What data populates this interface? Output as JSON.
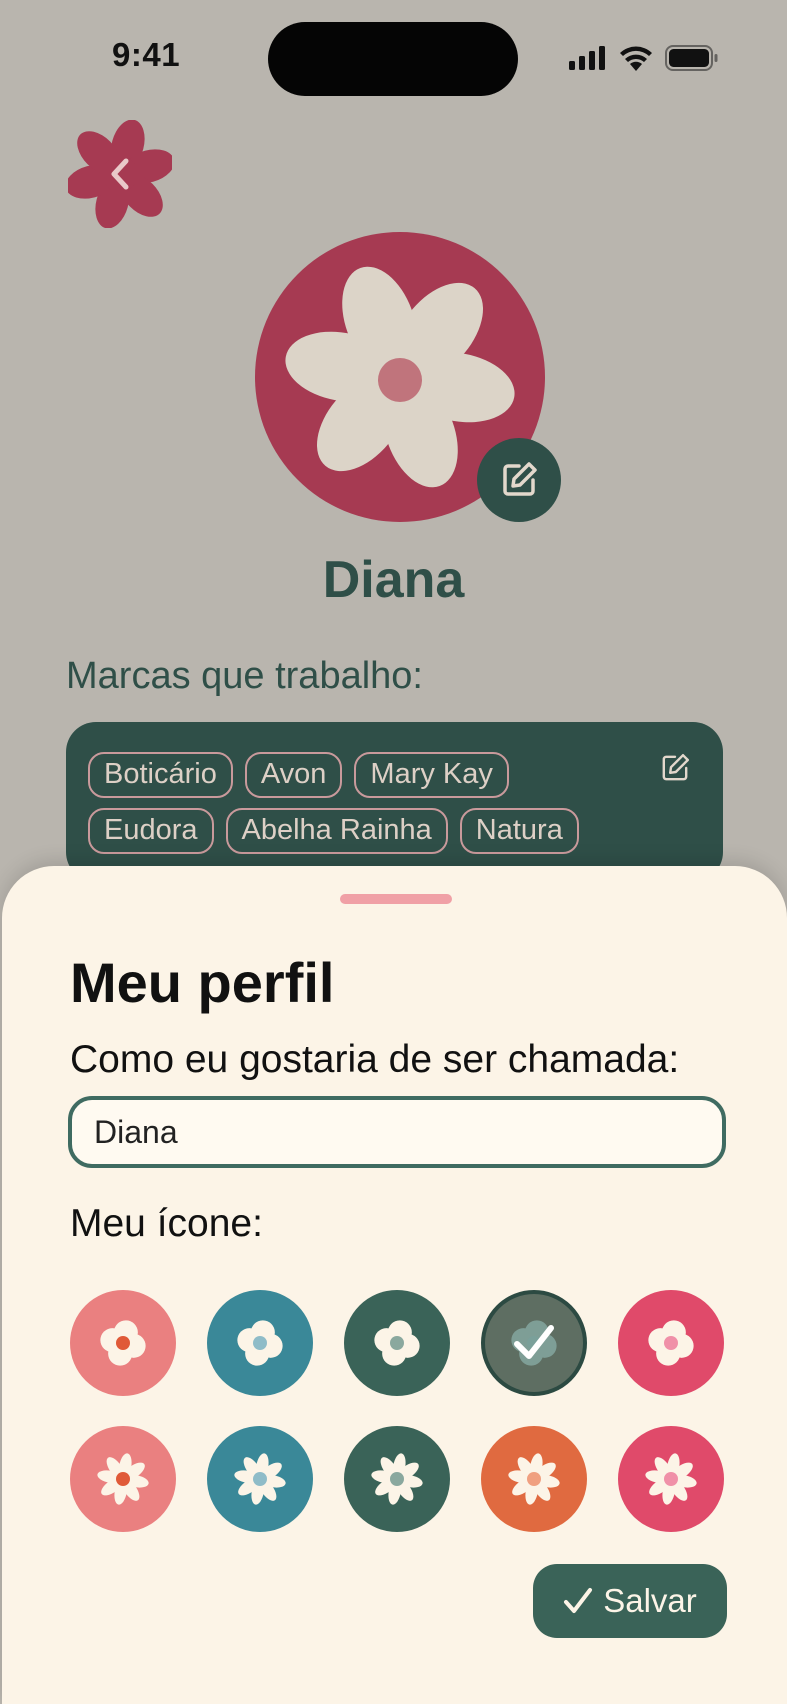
{
  "status_bar": {
    "time": "9:41",
    "icons": [
      "cellular-signal-icon",
      "wifi-icon",
      "battery-icon"
    ]
  },
  "header": {
    "back_icon": "flower-back-icon"
  },
  "profile": {
    "name": "Diana",
    "avatar_icon": "flower-avatar-icon",
    "edit_icon": "edit-icon"
  },
  "brands": {
    "title": "Marcas que trabalho:",
    "items": [
      "Boticário",
      "Avon",
      "Mary Kay",
      "Eudora",
      "Abelha Rainha",
      "Natura"
    ],
    "edit_icon": "edit-icon"
  },
  "sheet": {
    "title": "Meu perfil",
    "name_label": "Como eu gostaria de ser chamada:",
    "name_value": "Diana",
    "icons_label": "Meu ícone:",
    "icon_options": [
      {
        "shape": "round-flower",
        "bg": "#ea8080",
        "center": "#e05a38"
      },
      {
        "shape": "round-flower",
        "bg": "#3a8898",
        "center": "#8fbcc8"
      },
      {
        "shape": "round-flower",
        "bg": "#3a6358",
        "center": "#8aa89e"
      },
      {
        "shape": "round-flower",
        "bg": "#5e6e62",
        "center": "#7aa09a",
        "selected": true
      },
      {
        "shape": "round-flower",
        "bg": "#e04a6a",
        "center": "#f090a8"
      },
      {
        "shape": "star-flower",
        "bg": "#ea8080",
        "center": "#e05a38"
      },
      {
        "shape": "star-flower",
        "bg": "#3a8898",
        "center": "#8fbcc8"
      },
      {
        "shape": "star-flower",
        "bg": "#3a6358",
        "center": "#8aa89e"
      },
      {
        "shape": "star-flower",
        "bg": "#e06a40",
        "center": "#f0a080"
      },
      {
        "shape": "star-flower",
        "bg": "#e04a6a",
        "center": "#f090a8"
      }
    ],
    "save_label": "Salvar"
  },
  "colors": {
    "background": "#b9b5ae",
    "primary_green": "#2f4f48",
    "accent_raspberry": "#a63a52",
    "sheet_bg": "#fcf4e7"
  }
}
